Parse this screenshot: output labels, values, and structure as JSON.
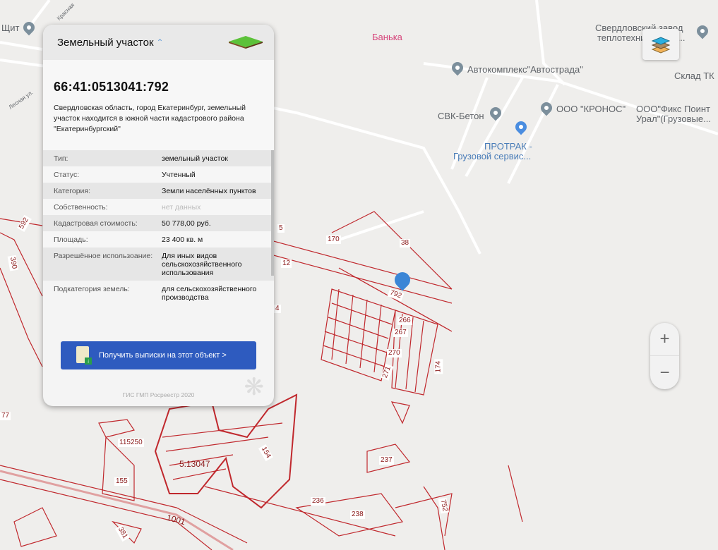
{
  "map": {
    "poi": [
      {
        "name": "Щит"
      },
      {
        "name": "Банька"
      },
      {
        "name": "Свердловский завод теплотехнического..."
      },
      {
        "name": "Автокомплекс\"Автострада\""
      },
      {
        "name": "Склад ТК"
      },
      {
        "name": "СВК-Бетон"
      },
      {
        "name": "ООО \"КРОНОС\""
      },
      {
        "name": "ООО\"Фикс Поинт Урал\"(Грузовые..."
      },
      {
        "name": "ПРОТРАК - Грузовой сервис..."
      }
    ],
    "poi_lines": {
      "svz1": "Свердловский завод",
      "svz2": "теплотехнического...",
      "fix1": "ООО\"Фикс Поинт",
      "fix2": "Урал\"(Грузовые...",
      "pro1": "ПРОТРАК -",
      "pro2": "Грузовой сервис..."
    },
    "streets": {
      "krasnaya": "Красная",
      "lesnaya": "Лесная ул."
    },
    "parcels": [
      "5",
      "170",
      "38",
      "12",
      "792",
      "266",
      "267",
      "270",
      "271",
      "174",
      "4",
      "390",
      "592",
      "77",
      "115250",
      "5:13047",
      "154",
      "237",
      "155",
      "236",
      "238",
      "752",
      "1001",
      "381"
    ]
  },
  "panel": {
    "title": "Земельный участок",
    "cadastral_number": "66:41:0513041:792",
    "address": "Свердловская область, город Екатеринбург, земельный участок находится в южной части кадастрового района \"Екатеринбургский\"",
    "rows": [
      {
        "k": "Тип:",
        "v": "земельный участок"
      },
      {
        "k": "Статус:",
        "v": "Учтенный"
      },
      {
        "k": "Категория:",
        "v": "Земли населённых пунктов"
      },
      {
        "k": "Собственность:",
        "v": "нет данных"
      },
      {
        "k": "Кадастровая стоимость:",
        "v": "50 778,00 руб."
      },
      {
        "k": "Площадь:",
        "v": "23 400 кв. м"
      },
      {
        "k": "Разрешённое использоание:",
        "v": "Для иных видов сельскохозяйственного использования"
      },
      {
        "k": "Подкатегория земель:",
        "v": "для сельскохозяйственного производства"
      }
    ],
    "button": "Получить выписки на этот объект >",
    "footer": "ГИС ГМП Росреестр 2020"
  },
  "controls": {
    "zoom_in": "+",
    "zoom_out": "−"
  },
  "colors": {
    "parcel": "#c0282d",
    "button": "#2e5bbf",
    "marker": "#3b86d6"
  }
}
